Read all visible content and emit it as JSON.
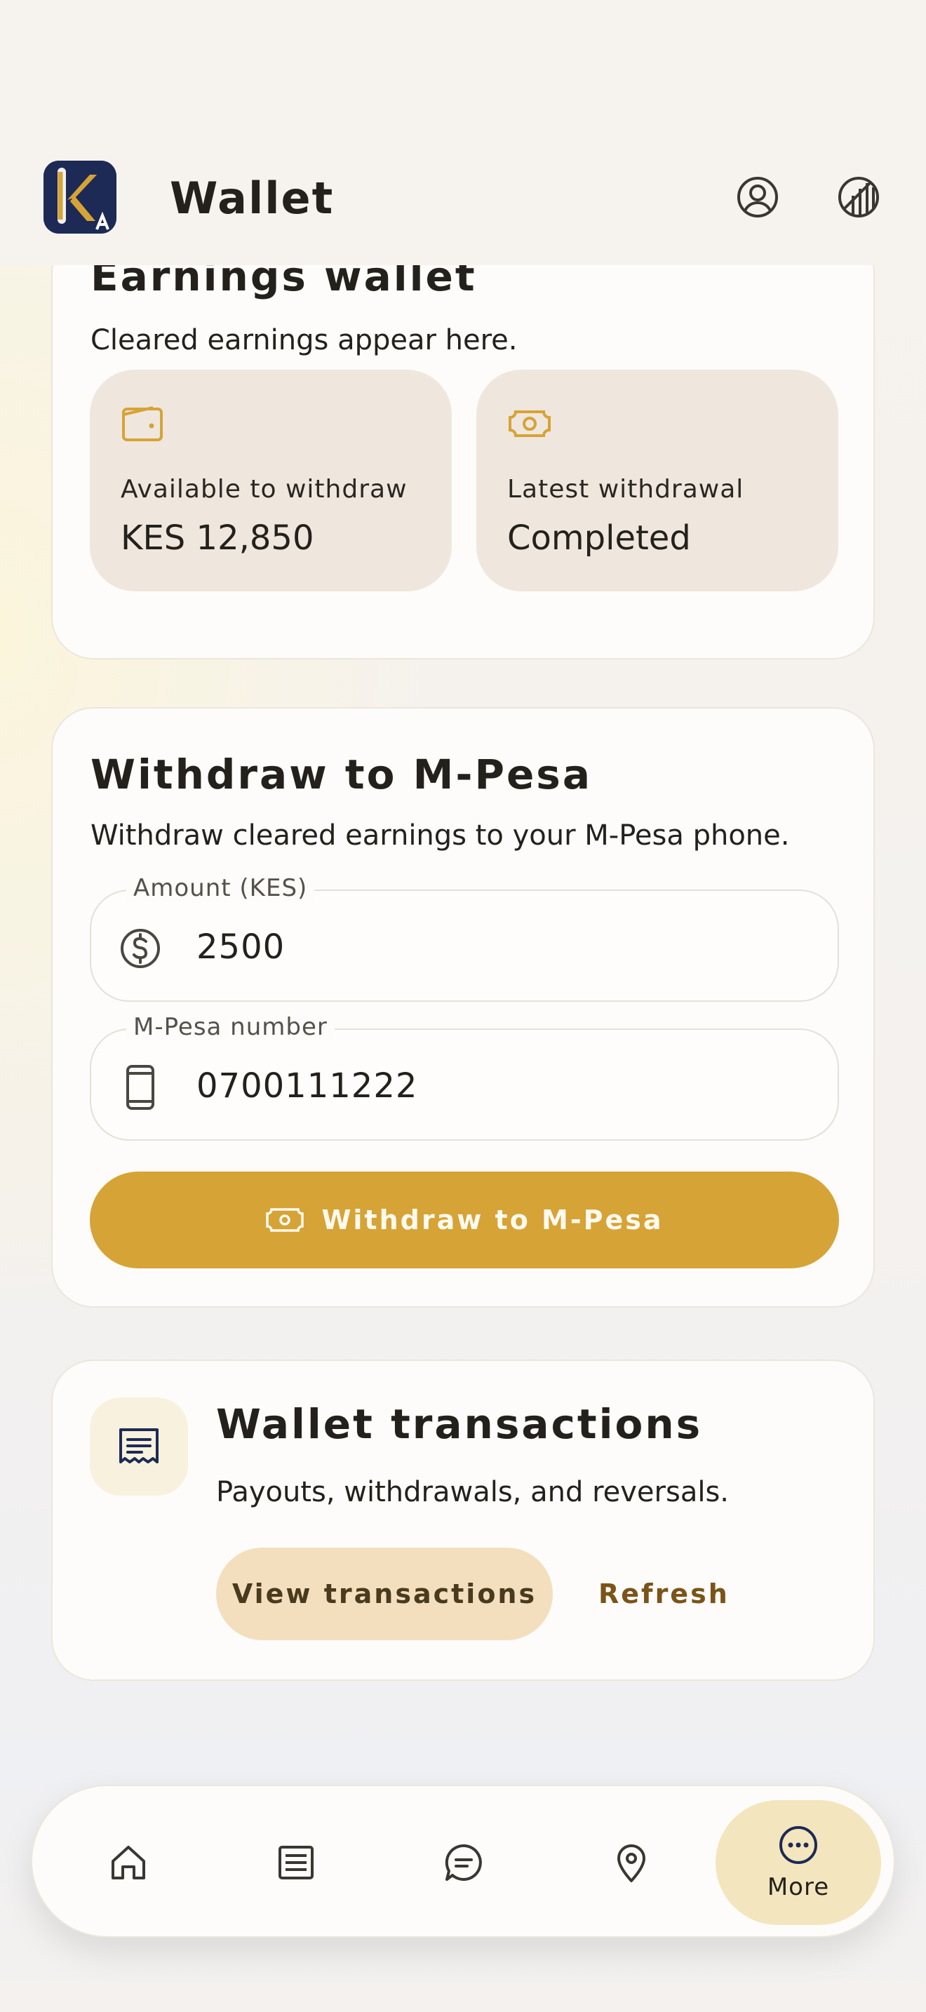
{
  "header": {
    "title": "Wallet",
    "logo_icon": "app-logo-k",
    "profile_icon": "user-circle-icon",
    "theme_icon": "contrast-icon"
  },
  "earnings_wallet": {
    "title": "Earnings wallet",
    "subtitle": "Cleared earnings appear here.",
    "stats": [
      {
        "icon": "wallet-icon",
        "label": "Available to withdraw",
        "value": "KES 12,850"
      },
      {
        "icon": "banknote-icon",
        "label": "Latest withdrawal",
        "value": "Completed"
      }
    ]
  },
  "withdraw": {
    "title": "Withdraw to M-Pesa",
    "subtitle": "Withdraw cleared earnings to your M-Pesa phone.",
    "amount": {
      "label": "Amount (KES)",
      "value": "2500",
      "icon": "dollar-circle-icon"
    },
    "phone": {
      "label": "M-Pesa number",
      "value": "0700111222",
      "icon": "phone-icon"
    },
    "button_label": "Withdraw to M-Pesa",
    "button_icon": "banknote-icon"
  },
  "transactions": {
    "title": "Wallet transactions",
    "subtitle": "Payouts, withdrawals, and reversals.",
    "icon": "receipt-icon",
    "view_label": "View transactions",
    "refresh_label": "Refresh"
  },
  "bottom_nav": {
    "items": [
      {
        "icon": "home-icon",
        "label": ""
      },
      {
        "icon": "list-icon",
        "label": ""
      },
      {
        "icon": "chat-icon",
        "label": ""
      },
      {
        "icon": "map-pin-icon",
        "label": ""
      },
      {
        "icon": "more-icon",
        "label": "More",
        "active": true
      }
    ]
  },
  "colors": {
    "accent": "#d6a336",
    "brand_navy": "#1d2a56",
    "stat_box": "#efe7de",
    "active_nav": "#f3e5bd",
    "secondary_button": "#f3dfbe",
    "link": "#7a5418"
  }
}
